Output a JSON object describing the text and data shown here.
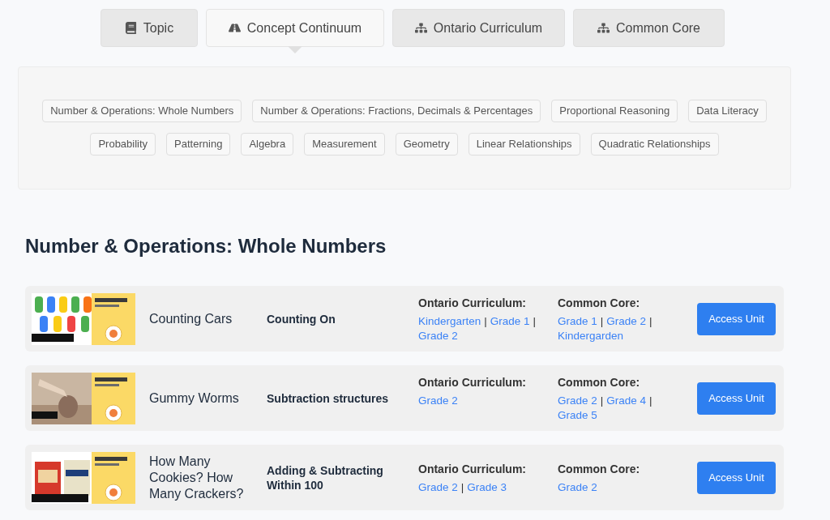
{
  "tabs": [
    {
      "label": "Topic",
      "selected": false
    },
    {
      "label": "Concept Continuum",
      "selected": true
    },
    {
      "label": "Ontario Curriculum",
      "selected": false
    },
    {
      "label": "Common Core",
      "selected": false
    }
  ],
  "topics": [
    [
      "Number & Operations: Whole Numbers",
      "Number & Operations: Fractions, Decimals & Percentages",
      "Proportional Reasoning",
      "Data Literacy"
    ],
    [
      "Probability",
      "Patterning",
      "Algebra",
      "Measurement",
      "Geometry",
      "Linear Relationships",
      "Quadratic Relationships"
    ]
  ],
  "section_title": "Number & Operations: Whole Numbers",
  "units": [
    {
      "thumbnail": {
        "kind": "picture"
      },
      "title": "Counting Cars",
      "concept": "Counting On",
      "curricula": [
        {
          "heading": "Ontario Curriculum:",
          "items": [
            {
              "kind": "link",
              "text": "Kindergarten"
            },
            {
              "kind": "sep",
              "text": "|"
            },
            {
              "kind": "link",
              "text": "Grade 1"
            },
            {
              "kind": "sep",
              "text": "|"
            },
            {
              "kind": "link",
              "text": "Grade 2"
            }
          ]
        },
        {
          "heading": "Common Core:",
          "items": [
            {
              "kind": "link",
              "text": "Grade 1"
            },
            {
              "kind": "sep",
              "text": "|"
            },
            {
              "kind": "link",
              "text": "Grade 2"
            },
            {
              "kind": "sep",
              "text": "|"
            },
            {
              "kind": "link",
              "text": "Kindergarden"
            }
          ]
        }
      ],
      "button": "Access Unit"
    },
    {
      "thumbnail": {
        "kind": "picture"
      },
      "title": "Gummy Worms",
      "concept": "Subtraction structures",
      "curricula": [
        {
          "heading": "Ontario Curriculum:",
          "items": [
            {
              "kind": "link",
              "text": "Grade 2"
            }
          ]
        },
        {
          "heading": "Common Core:",
          "items": [
            {
              "kind": "link",
              "text": "Grade 2"
            },
            {
              "kind": "sep",
              "text": "|"
            },
            {
              "kind": "link",
              "text": "Grade 4"
            },
            {
              "kind": "sep",
              "text": "|"
            },
            {
              "kind": "link",
              "text": "Grade 5"
            }
          ]
        }
      ],
      "button": "Access Unit"
    },
    {
      "thumbnail": {
        "kind": "picture"
      },
      "title": "How Many Cookies? How Many Crackers?",
      "concept": "Adding & Subtracting Within 100",
      "curricula": [
        {
          "heading": "Ontario Curriculum:",
          "items": [
            {
              "kind": "link",
              "text": "Grade 2"
            },
            {
              "kind": "sep",
              "text": "|"
            },
            {
              "kind": "link",
              "text": "Grade 3"
            }
          ]
        },
        {
          "heading": "Common Core:",
          "items": [
            {
              "kind": "link",
              "text": "Grade 2"
            }
          ]
        }
      ],
      "button": "Access Unit"
    }
  ]
}
